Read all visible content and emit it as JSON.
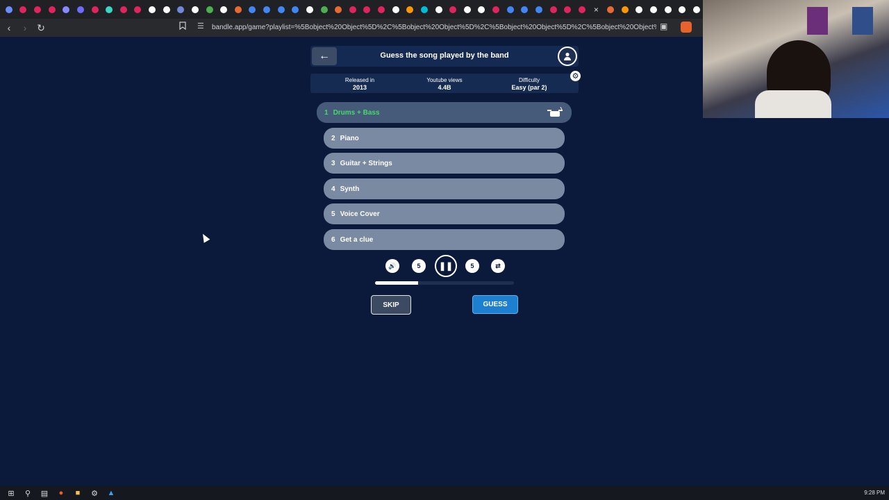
{
  "browser": {
    "url": "bandle.app/game?playlist=%5Bobject%20Object%5D%2C%5Bobject%20Object%5D%2C%5Bobject%20Object%5D%2C%5Bobject%20Object%5D%2C%5..."
  },
  "header": {
    "title": "Guess the song played by the band"
  },
  "info": {
    "released_label": "Released in",
    "released_value": "2013",
    "views_label": "Youtube views",
    "views_value": "4.4B",
    "difficulty_label": "Difficulty",
    "difficulty_value": "Easy (par 2)"
  },
  "tracks": [
    {
      "num": "1",
      "label": "Drums + Bass"
    },
    {
      "num": "2",
      "label": "Piano"
    },
    {
      "num": "3",
      "label": "Guitar + Strings"
    },
    {
      "num": "4",
      "label": "Synth"
    },
    {
      "num": "5",
      "label": "Voice Cover"
    },
    {
      "num": "6",
      "label": "Get a clue"
    }
  ],
  "player": {
    "rewind_label": "5",
    "forward_label": "5",
    "progress": 0.31
  },
  "actions": {
    "skip_label": "SKIP",
    "guess_label": "GUESS"
  },
  "taskbar": {
    "clock": "9:28 PM"
  },
  "colors": {
    "background": "#0b1a3a",
    "active_track_text": "#45d96b",
    "guess_button": "#1d7fd0"
  }
}
